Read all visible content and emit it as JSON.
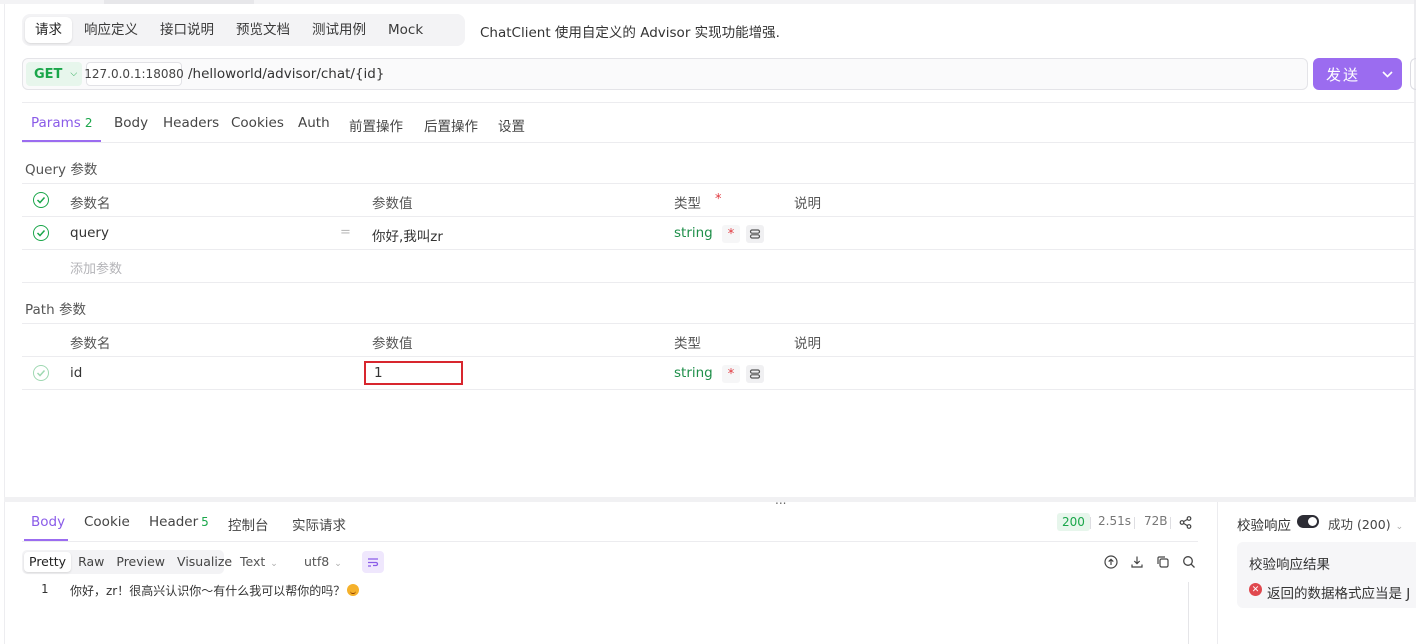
{
  "top_tabs": [
    {
      "label": "请求",
      "active": true
    },
    {
      "label": "响应定义",
      "active": false
    },
    {
      "label": "接口说明",
      "active": false
    },
    {
      "label": "预览文档",
      "active": false
    },
    {
      "label": "测试用例",
      "active": false
    },
    {
      "label": "Mock",
      "active": false
    }
  ],
  "description": "ChatClient 使用自定义的 Advisor 实现功能增强.",
  "request": {
    "method": "GET",
    "host": "127.0.0.1:18080",
    "path": "/helloworld/advisor/chat/{id}",
    "send_label": "发送"
  },
  "param_tabs": {
    "params_label": "Params",
    "params_count": "2",
    "body": "Body",
    "headers": "Headers",
    "cookies": "Cookies",
    "auth": "Auth",
    "pre": "前置操作",
    "post": "后置操作",
    "settings": "设置"
  },
  "query_section": {
    "title": "Query 参数",
    "col_name": "参数名",
    "col_value": "参数值",
    "col_type": "类型",
    "required_mark": "*",
    "col_desc": "说明",
    "rows": [
      {
        "name": "query",
        "eq": "=",
        "value": "你好,我叫zr",
        "type": "string",
        "required": "*"
      }
    ],
    "add_placeholder": "添加参数"
  },
  "path_section": {
    "title": "Path 参数",
    "col_name": "参数名",
    "col_value": "参数值",
    "col_type": "类型",
    "col_desc": "说明",
    "rows": [
      {
        "name": "id",
        "value": "1",
        "type": "string",
        "required": "*"
      }
    ]
  },
  "splitter_dots": "...",
  "response_tabs": {
    "body": "Body",
    "cookie": "Cookie",
    "header_label": "Header",
    "header_count": "5",
    "console": "控制台",
    "actual": "实际请求"
  },
  "response_meta": {
    "status": "200",
    "time": "2.51s",
    "size": "72B"
  },
  "format_tabs": [
    "Pretty",
    "Raw",
    "Preview",
    "Visualize"
  ],
  "format_active": "Pretty",
  "content_type": "Text",
  "encoding": "utf8",
  "response_body": {
    "line_number": "1",
    "text": "你好，zr！很高兴认识你～有什么我可以帮你的吗？"
  },
  "validation": {
    "label": "校验响应",
    "toggle_on": true,
    "status": "成功 (200)",
    "result_title": "校验响应结果",
    "error_text": "返回的数据格式应当是 J"
  },
  "colors": {
    "accent": "#9b6cf0",
    "success": "#1aa64a",
    "error": "#e0383e"
  }
}
